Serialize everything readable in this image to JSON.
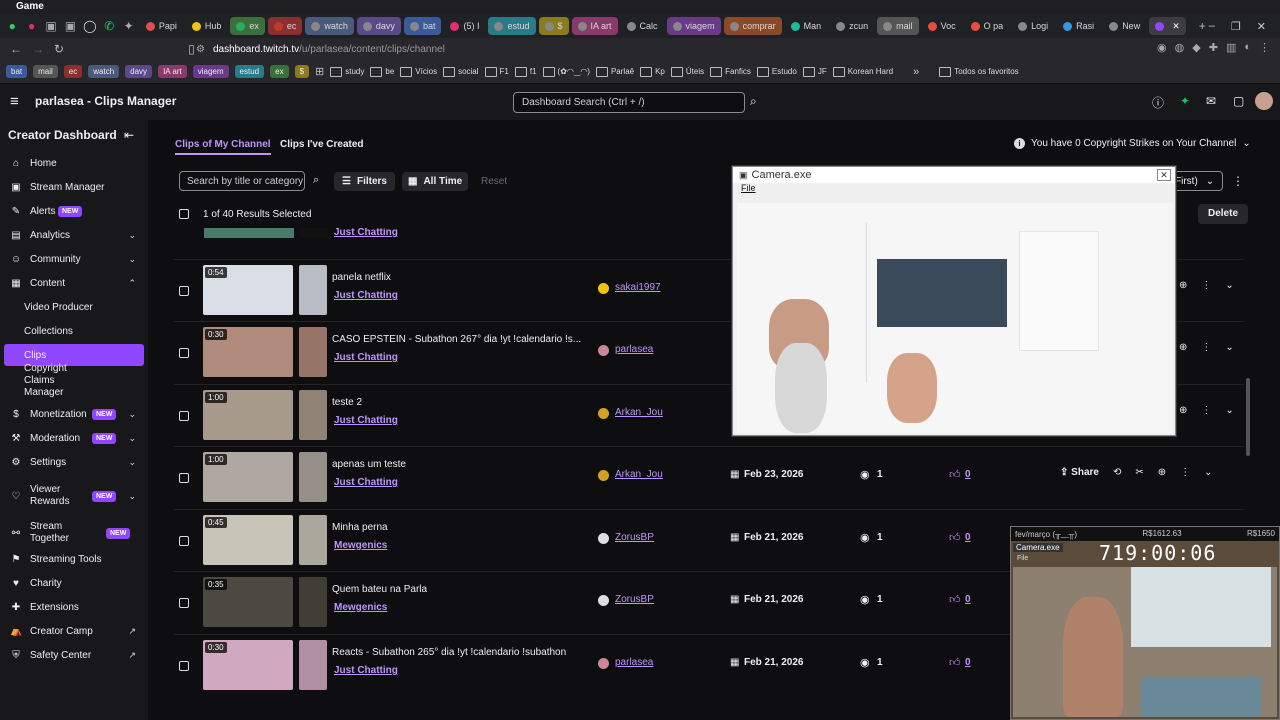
{
  "window": {
    "title": "Game"
  },
  "tabs": [
    {
      "label": "Papi",
      "color": "#e04e4e"
    },
    {
      "label": "Hub",
      "color": "#f1c40f"
    },
    {
      "label": "ex",
      "color": "#27ae60",
      "bg": "#3d6e3d"
    },
    {
      "label": "ec",
      "color": "#c0392b",
      "bg": "#8a3030"
    },
    {
      "label": "watch",
      "color": "#888",
      "bg": "#4a5a7a"
    },
    {
      "label": "davy",
      "color": "#888",
      "bg": "#5a4a8a"
    },
    {
      "label": "bat",
      "color": "#888",
      "bg": "#3a5a9a"
    },
    {
      "label": "(5) I",
      "color": "#e1306c"
    },
    {
      "label": "estud",
      "color": "#888",
      "bg": "#2a7a8a"
    },
    {
      "label": "$",
      "color": "#888",
      "bg": "#8a7a20"
    },
    {
      "label": "IA art",
      "color": "#888",
      "bg": "#8a3a6a"
    },
    {
      "label": "Calc",
      "color": "#888"
    },
    {
      "label": "viagem",
      "color": "#888",
      "bg": "#6a3a8a"
    },
    {
      "label": "comprar",
      "color": "#888",
      "bg": "#8a4a2a"
    },
    {
      "label": "Man",
      "color": "#1abc9c"
    },
    {
      "label": "zcun",
      "color": "#888"
    },
    {
      "label": "mail",
      "color": "#888",
      "bg": "#555"
    },
    {
      "label": "Voc",
      "color": "#e74c3c"
    },
    {
      "label": "O pa",
      "color": "#e74c3c"
    },
    {
      "label": "Logi",
      "color": "#888"
    },
    {
      "label": "Rasi",
      "color": "#3498db"
    },
    {
      "label": "New",
      "color": "#888"
    },
    {
      "label": "",
      "color": "#9146ff",
      "active": true
    }
  ],
  "address": {
    "url_host": "dashboard.twitch.tv",
    "url_path": "/u/parlasea/content/clips/channel"
  },
  "bookmarks": [
    "bat",
    "mail",
    "ec",
    "watch",
    "davy",
    "IA art",
    "viagem",
    "estud",
    "ex",
    "$"
  ],
  "bookmark_folders": [
    "study",
    "be",
    "Vícios",
    "social",
    "F1",
    "f1",
    "(✿◠‿◠)",
    "Parlaê",
    "Kp",
    "Úteis",
    "Fanfics",
    "Estudo",
    "JF",
    "Korean Hard"
  ],
  "bookmark_all": "Todos os favoritos",
  "header": {
    "title": "parlasea - Clips Manager",
    "search_placeholder": "Dashboard Search (Ctrl + /)"
  },
  "sidebar": {
    "title": "Creator Dashboard",
    "items": [
      {
        "label": "Home",
        "icon": "⌂"
      },
      {
        "label": "Stream Manager",
        "icon": "▣"
      },
      {
        "label": "Alerts",
        "icon": "✎",
        "badge": "NEW"
      },
      {
        "label": "Analytics",
        "icon": "▤",
        "chev": "⌄"
      },
      {
        "label": "Community",
        "icon": "☺",
        "chev": "⌄"
      },
      {
        "label": "Content",
        "icon": "▦",
        "chev": "⌃"
      },
      {
        "label": "Video Producer",
        "sub": true
      },
      {
        "label": "Collections",
        "sub": true
      },
      {
        "label": "Clips",
        "sub": true,
        "active": true
      },
      {
        "label": "Copyright Claims Manager",
        "sub": true
      },
      {
        "label": "Monetization",
        "icon": "$",
        "badge": "NEW",
        "chev": "⌄"
      },
      {
        "label": "Moderation",
        "icon": "⚒",
        "badge": "NEW",
        "chev": "⌄"
      },
      {
        "label": "Settings",
        "icon": "⚙",
        "chev": "⌄"
      },
      {
        "label": "Viewer Rewards",
        "icon": "♡",
        "badge": "NEW",
        "chev": "⌄"
      },
      {
        "label": "Stream Together",
        "icon": "⚯",
        "badge": "NEW"
      },
      {
        "label": "Streaming Tools",
        "icon": "⚑"
      },
      {
        "label": "Charity",
        "icon": "♥"
      },
      {
        "label": "Extensions",
        "icon": "✚"
      },
      {
        "label": "Creator Camp",
        "icon": "⛺",
        "ext": "↗"
      },
      {
        "label": "Safety Center",
        "icon": "⛨",
        "ext": "↗"
      }
    ]
  },
  "content": {
    "tabs": [
      "Clips of My Channel",
      "Clips I've Created"
    ],
    "copyright": "You have 0 Copyright Strikes on Your Channel",
    "search_placeholder": "Search by title or category",
    "filters": "Filters",
    "time": "All Time",
    "reset": "Reset",
    "sort_suffix": "First)",
    "delete": "Delete",
    "selected": "1 of 40 Results Selected"
  },
  "partial_row": {
    "game": "Just Chatting"
  },
  "clips": [
    {
      "duration": "0:54",
      "title": "panela netflix",
      "game": "Just Chatting",
      "user": "sakai1997",
      "date": "",
      "views": "",
      "likes": "",
      "thumb": "#d8dde6",
      "av": "#f1c40f"
    },
    {
      "duration": "0:30",
      "title": "CASO EPSTEIN - Subathon 267° dia !yt !calendario !s...",
      "game": "Just Chatting",
      "user": "parlasea",
      "date": "",
      "views": "",
      "likes": "",
      "thumb": "#b08a7a",
      "av": "#c89"
    },
    {
      "duration": "1:00",
      "title": "teste 2",
      "game": "Just Chatting",
      "user": "Arkan_Jou",
      "date": "",
      "views": "",
      "likes": "",
      "thumb": "#a89a8a",
      "av": "#d4a020"
    },
    {
      "duration": "1:00",
      "title": "apenas um teste",
      "game": "Just Chatting",
      "user": "Arkan_Jou",
      "date": "Feb 23, 2026",
      "views": "1",
      "likes": "0",
      "thumb": "#b0a8a0",
      "av": "#d4a020"
    },
    {
      "duration": "0:45",
      "title": "Minha perna",
      "game": "Mewgenics",
      "user": "ZorusBP",
      "date": "Feb 21, 2026",
      "views": "1",
      "likes": "0",
      "thumb": "#c8c4b8",
      "av": "#ddd"
    },
    {
      "duration": "0:35",
      "title": "Quem bateu na Parla",
      "game": "Mewgenics",
      "user": "ZorusBP",
      "date": "Feb 21, 2026",
      "views": "1",
      "likes": "0",
      "thumb": "#4a4a40",
      "av": "#ddd"
    },
    {
      "duration": "0:30",
      "title": "Reacts - Subathon 265° dia !yt !calendario !subathon",
      "game": "Just Chatting",
      "user": "parlasea",
      "date": "Feb 21, 2026",
      "views": "1",
      "likes": "0",
      "thumb": "#d0a8c0",
      "av": "#c89"
    }
  ],
  "row_actions": {
    "share": "Share"
  },
  "camera_popup": {
    "title": "Camera.exe",
    "menu": "File"
  },
  "mini_overlay": {
    "left_label": "fev/março (╥﹏╥)",
    "money1": "R$1612.63",
    "money2": "R$1650",
    "timer": "719:00:06",
    "cam_title": "Camera.exe",
    "cam_menu": "File"
  }
}
